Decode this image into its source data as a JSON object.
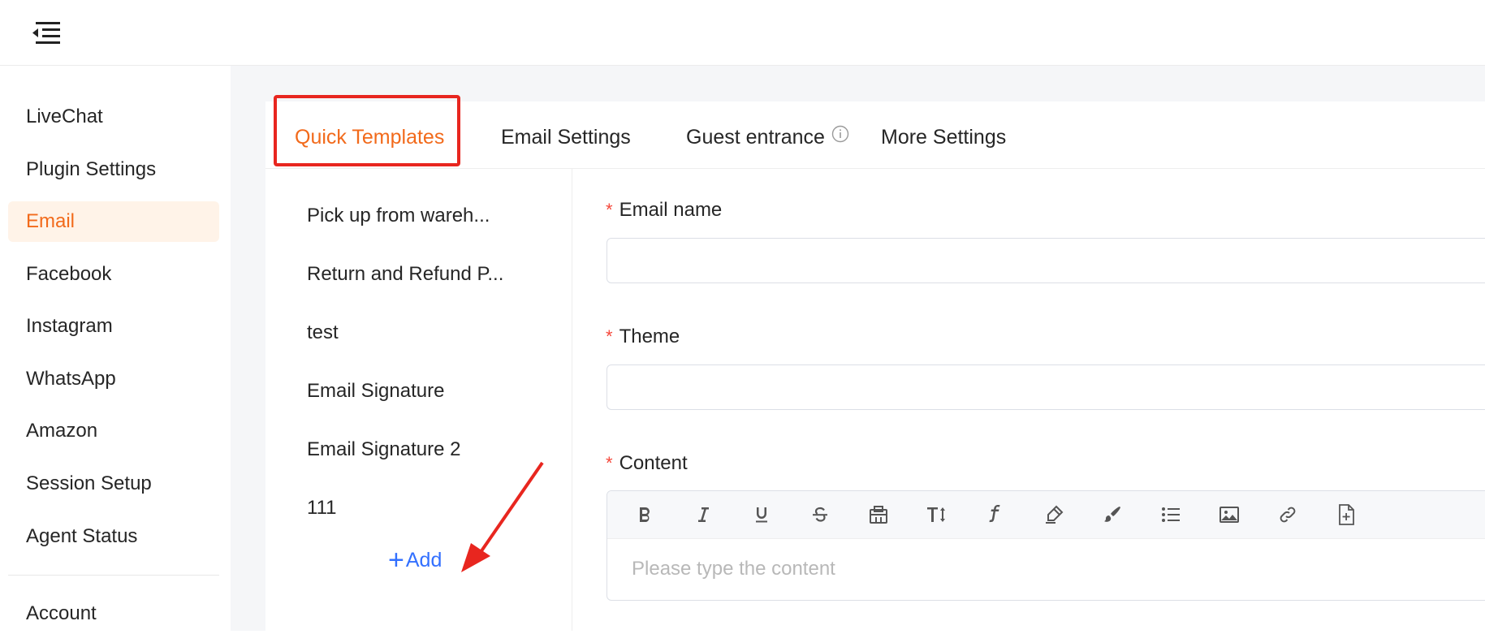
{
  "header": {
    "menu_icon": "menu-fold-icon"
  },
  "sidebar": {
    "items": [
      {
        "label": "LiveChat",
        "active": false
      },
      {
        "label": "Plugin Settings",
        "active": false
      },
      {
        "label": "Email",
        "active": true
      },
      {
        "label": "Facebook",
        "active": false
      },
      {
        "label": "Instagram",
        "active": false
      },
      {
        "label": "WhatsApp",
        "active": false
      },
      {
        "label": "Amazon",
        "active": false
      },
      {
        "label": "Session Setup",
        "active": false
      },
      {
        "label": "Agent Status",
        "active": false
      },
      {
        "label": "Account",
        "active": false
      }
    ]
  },
  "tabs": [
    {
      "label": "Quick Templates",
      "active": true
    },
    {
      "label": "Email Settings",
      "active": false
    },
    {
      "label": "Guest entrance",
      "active": false,
      "icon": "info-icon"
    },
    {
      "label": "More Settings",
      "active": false
    }
  ],
  "templates": {
    "items": [
      "Pick up from wareh...",
      "Return and Refund P...",
      "test",
      "Email Signature",
      "Email Signature 2",
      "111"
    ],
    "add_label": "Add"
  },
  "form": {
    "email_name": {
      "label": "Email name",
      "required_mark": "*",
      "value": ""
    },
    "theme": {
      "label": "Theme",
      "required_mark": "*",
      "value": ""
    },
    "content": {
      "label": "Content",
      "required_mark": "*",
      "placeholder": "Please type the content",
      "toolbar_icons": [
        "bold-icon",
        "italic-icon",
        "underline-icon",
        "strikethrough-icon",
        "paint-format-icon",
        "font-size-icon",
        "font-family-icon",
        "highlight-icon",
        "brush-icon",
        "bullet-list-icon",
        "image-icon",
        "link-icon",
        "insert-file-icon"
      ]
    }
  },
  "colors": {
    "accent": "#f26a1b",
    "active_bg": "#fff3e8",
    "link": "#3370ff",
    "required": "#f5483b",
    "annotation": "#e8261f"
  }
}
